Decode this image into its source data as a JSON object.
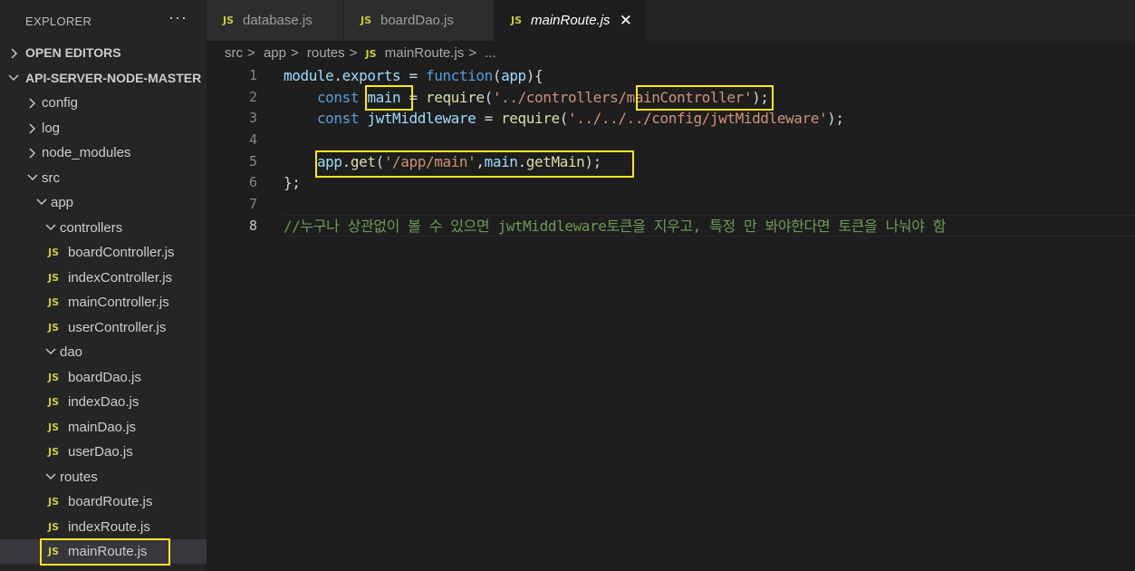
{
  "sidebar": {
    "title": "EXPLORER",
    "more_icon": "ellipsis-icon",
    "open_editors": "OPEN EDITORS",
    "project": "API-SERVER-NODE-MASTER",
    "tree": [
      {
        "label": "config",
        "kind": "folder",
        "expanded": false
      },
      {
        "label": "log",
        "kind": "folder",
        "expanded": false
      },
      {
        "label": "node_modules",
        "kind": "folder",
        "expanded": false
      },
      {
        "label": "src",
        "kind": "folder",
        "expanded": true
      },
      {
        "label": "app",
        "kind": "folder",
        "expanded": true
      },
      {
        "label": "controllers",
        "kind": "folder",
        "expanded": true
      },
      {
        "label": "boardController.js",
        "kind": "file"
      },
      {
        "label": "indexController.js",
        "kind": "file"
      },
      {
        "label": "mainController.js",
        "kind": "file"
      },
      {
        "label": "userController.js",
        "kind": "file"
      },
      {
        "label": "dao",
        "kind": "folder",
        "expanded": true
      },
      {
        "label": "boardDao.js",
        "kind": "file"
      },
      {
        "label": "indexDao.js",
        "kind": "file"
      },
      {
        "label": "mainDao.js",
        "kind": "file"
      },
      {
        "label": "userDao.js",
        "kind": "file"
      },
      {
        "label": "routes",
        "kind": "folder",
        "expanded": true
      },
      {
        "label": "boardRoute.js",
        "kind": "file"
      },
      {
        "label": "indexRoute.js",
        "kind": "file"
      },
      {
        "label": "mainRoute.js",
        "kind": "file",
        "selected": true
      }
    ],
    "file_icon_text": "JS"
  },
  "tabs": [
    {
      "label": "database.js",
      "active": false
    },
    {
      "label": "boardDao.js",
      "active": false
    },
    {
      "label": "mainRoute.js",
      "active": true,
      "close": "✕"
    }
  ],
  "breadcrumb": {
    "parts": [
      "src",
      "app",
      "routes"
    ],
    "file": "mainRoute.js",
    "tail": "...",
    "separator": ">"
  },
  "editor": {
    "line_numbers": [
      "1",
      "2",
      "3",
      "4",
      "5",
      "6",
      "7",
      "8"
    ],
    "current_line": "8",
    "lines": {
      "l1": {
        "a": "module",
        "b": ".",
        "c": "exports",
        "d": " = ",
        "e": "function",
        "f": "(",
        "g": "app",
        "h": "){"
      },
      "l2": {
        "a": "const",
        "b": "main",
        "c": " = ",
        "d": "require",
        "e": "(",
        "f": "'../controllers/mainController'",
        "g": ");"
      },
      "l3": {
        "a": "const",
        "b": "jwtMiddleware",
        "c": " = ",
        "d": "require",
        "e": "(",
        "f": "'../../../config/jwtMiddleware'",
        "g": ");"
      },
      "l5": {
        "a": "app",
        "b": ".",
        "c": "get",
        "d": "(",
        "e": "'/app/main'",
        "f": ",",
        "g": "main",
        "h": ".",
        "i": "getMain",
        "j": ");"
      },
      "l6": {
        "a": "};"
      },
      "l8": {
        "a": "//누구나 상관없이 볼 수 있으면 jwtMiddleware토큰을 지우고, 특정 만 봐야한다면 토큰을 나눠야 함"
      }
    }
  },
  "colors": {
    "highlight_box": "#ffe81a",
    "keyword": "#569cd6",
    "variable": "#9cdcfe",
    "function": "#dcdcaa",
    "string": "#ce9178",
    "comment": "#6a9955",
    "js_icon": "#cbcb41"
  }
}
